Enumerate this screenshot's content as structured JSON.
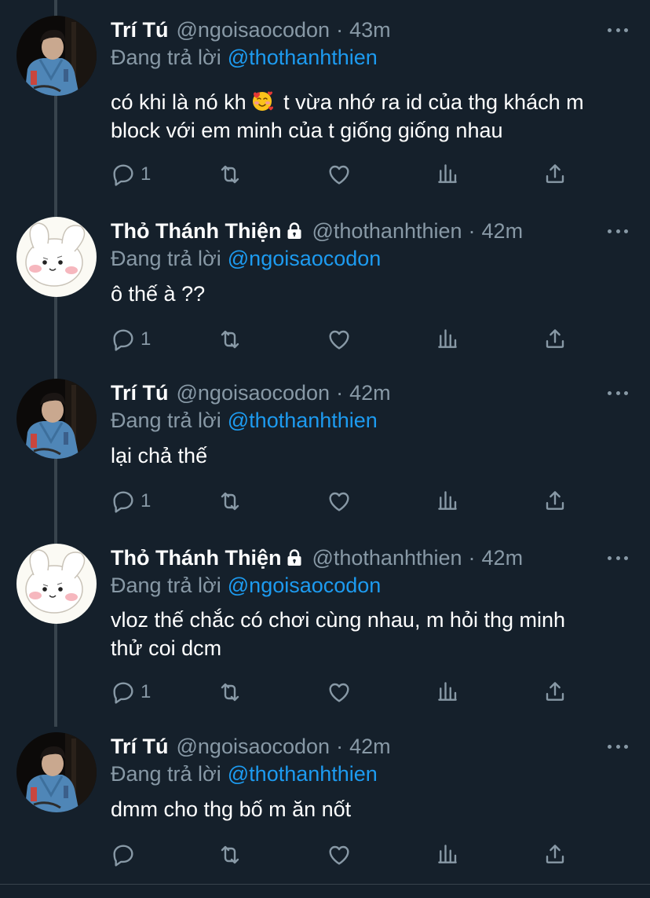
{
  "colors": {
    "background": "#15202b",
    "secondary": "#8899a6",
    "accent": "#1d9bf0",
    "divider": "#38444d"
  },
  "tweets": [
    {
      "name": "Trí Tú",
      "handle": "@ngoisaocodon",
      "dot": "·",
      "time": "43m",
      "reply_prefix": "Đang trả lời",
      "reply_to": "@thothanhthien",
      "text_lines": [
        "có khi là nó kh",
        "t vừa nhớ ra id của thg khách m",
        "block với em minh của t giống giống nhau"
      ],
      "emoji": "smiling-face-with-hearts",
      "reply_count": "1",
      "avatar": "person-photo-avatar",
      "locked": false
    },
    {
      "name": "Thỏ Thánh Thiện",
      "handle": "@thothanhthien",
      "dot": "·",
      "time": "42m",
      "reply_prefix": "Đang trả lời",
      "reply_to": "@ngoisaocodon",
      "text_lines": [
        "ô thế à ??"
      ],
      "reply_count": "1",
      "avatar": "bunny-avatar",
      "locked": true
    },
    {
      "name": "Trí Tú",
      "handle": "@ngoisaocodon",
      "dot": "·",
      "time": "42m",
      "reply_prefix": "Đang trả lời",
      "reply_to": "@thothanhthien",
      "text_lines": [
        "lại chả thế"
      ],
      "reply_count": "1",
      "avatar": "person-photo-avatar",
      "locked": false
    },
    {
      "name": "Thỏ Thánh Thiện",
      "handle": "@thothanhthien",
      "dot": "·",
      "time": "42m",
      "reply_prefix": "Đang trả lời",
      "reply_to": "@ngoisaocodon",
      "text_lines": [
        "vloz thế chắc có chơi cùng nhau, m hỏi thg minh",
        "thử coi dcm"
      ],
      "reply_count": "1",
      "avatar": "bunny-avatar",
      "locked": true
    },
    {
      "name": "Trí Tú",
      "handle": "@ngoisaocodon",
      "dot": "·",
      "time": "42m",
      "reply_prefix": "Đang trả lời",
      "reply_to": "@thothanhthien",
      "text_lines": [
        "dmm cho thg bố m ăn nốt"
      ],
      "reply_count": "",
      "avatar": "person-photo-avatar",
      "locked": false
    }
  ]
}
